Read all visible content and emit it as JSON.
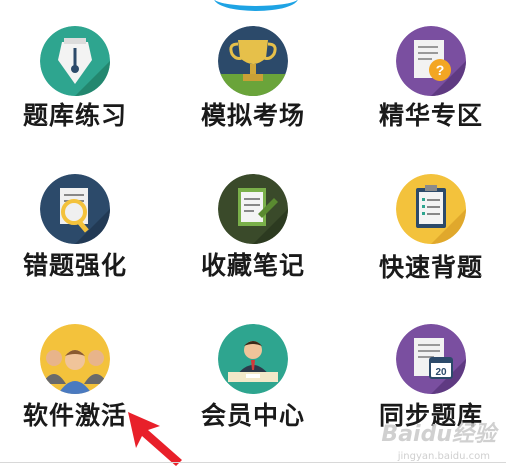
{
  "menu": {
    "items": [
      {
        "label": "题库练习",
        "icon": "fountain-pen-icon"
      },
      {
        "label": "模拟考场",
        "icon": "trophy-icon"
      },
      {
        "label": "精华专区",
        "icon": "question-document-icon"
      },
      {
        "label": "错题强化",
        "icon": "magnifier-document-icon"
      },
      {
        "label": "收藏笔记",
        "icon": "notebook-pen-icon"
      },
      {
        "label": "快速背题",
        "icon": "clipboard-checklist-icon"
      },
      {
        "label": "软件激活",
        "icon": "people-group-icon"
      },
      {
        "label": "会员中心",
        "icon": "member-person-icon"
      },
      {
        "label": "同步题库",
        "icon": "calendar-document-icon"
      }
    ],
    "calendar_day": "20"
  },
  "watermark": {
    "text": "Baidu经验",
    "sub": "jingyan.baidu.com"
  },
  "colors": {
    "label": "#1a1a1a",
    "arrow": "#e8202a",
    "teal": "#2ea58f",
    "navy": "#2c4a6a",
    "purple": "#7a4fa0",
    "yellow": "#f3c23c"
  }
}
